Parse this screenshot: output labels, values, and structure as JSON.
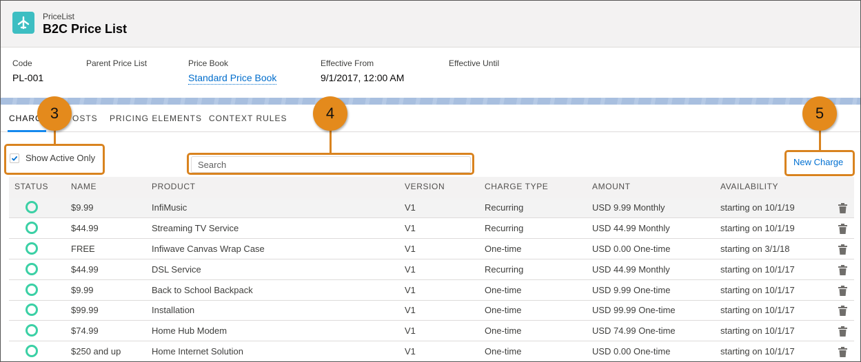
{
  "header": {
    "object_type": "PriceList",
    "record_title": "B2C Price List"
  },
  "highlights": {
    "fields": [
      {
        "label": "Code",
        "value": "PL-001"
      },
      {
        "label": "Parent Price List",
        "value": ""
      },
      {
        "label": "Price Book",
        "value": "Standard Price Book"
      },
      {
        "label": "Effective From",
        "value": "9/1/2017, 12:00 AM"
      },
      {
        "label": "Effective Until",
        "value": ""
      }
    ]
  },
  "tabs": [
    "CHARGES",
    "COSTS",
    "PRICING ELEMENTS",
    "CONTEXT RULES"
  ],
  "tabs_visible": [
    "CHARG",
    "OSTS",
    "PRICING ELEMENTS",
    "CONTEXT RULES"
  ],
  "toolbar": {
    "show_active_label": "Show Active Only",
    "show_active_checked": true,
    "search_placeholder": "Search",
    "new_charge_label": "New Charge"
  },
  "table": {
    "columns": [
      "STATUS",
      "NAME",
      "PRODUCT",
      "VERSION",
      "CHARGE TYPE",
      "AMOUNT",
      "AVAILABILITY"
    ],
    "rows": [
      {
        "name": "$9.99",
        "product": "InfiMusic",
        "version": "V1",
        "charge_type": "Recurring",
        "amount": "USD 9.99 Monthly",
        "availability": "starting on 10/1/19"
      },
      {
        "name": "$44.99",
        "product": "Streaming TV Service",
        "version": "V1",
        "charge_type": "Recurring",
        "amount": "USD 44.99 Monthly",
        "availability": "starting on 10/1/19"
      },
      {
        "name": "FREE",
        "product": "Infiwave Canvas Wrap Case",
        "version": "V1",
        "charge_type": "One-time",
        "amount": "USD 0.00 One-time",
        "availability": "starting on 3/1/18"
      },
      {
        "name": "$44.99",
        "product": "DSL Service",
        "version": "V1",
        "charge_type": "Recurring",
        "amount": "USD 44.99 Monthly",
        "availability": "starting on 10/1/17"
      },
      {
        "name": "$9.99",
        "product": "Back to School Backpack",
        "version": "V1",
        "charge_type": "One-time",
        "amount": "USD 9.99 One-time",
        "availability": "starting on 10/1/17"
      },
      {
        "name": "$99.99",
        "product": "Installation",
        "version": "V1",
        "charge_type": "One-time",
        "amount": "USD 99.99 One-time",
        "availability": "starting on 10/1/17"
      },
      {
        "name": "$74.99",
        "product": "Home Hub Modem",
        "version": "V1",
        "charge_type": "One-time",
        "amount": "USD 74.99 One-time",
        "availability": "starting on 10/1/17"
      },
      {
        "name": "$250 and up",
        "product": "Home Internet Solution",
        "version": "V1",
        "charge_type": "One-time",
        "amount": "USD 0.00 One-time",
        "availability": "starting on 10/1/17"
      }
    ]
  },
  "callouts": [
    "3",
    "4",
    "5"
  ],
  "colors": {
    "accent": "#e48a1c",
    "status_active": "#3bd0a5",
    "link": "#0070d2",
    "app_icon": "#3dbec2"
  },
  "icons": {
    "app": "price-list-icon",
    "status": "active-status-icon",
    "delete": "trash-icon",
    "check": "checkmark-icon"
  }
}
